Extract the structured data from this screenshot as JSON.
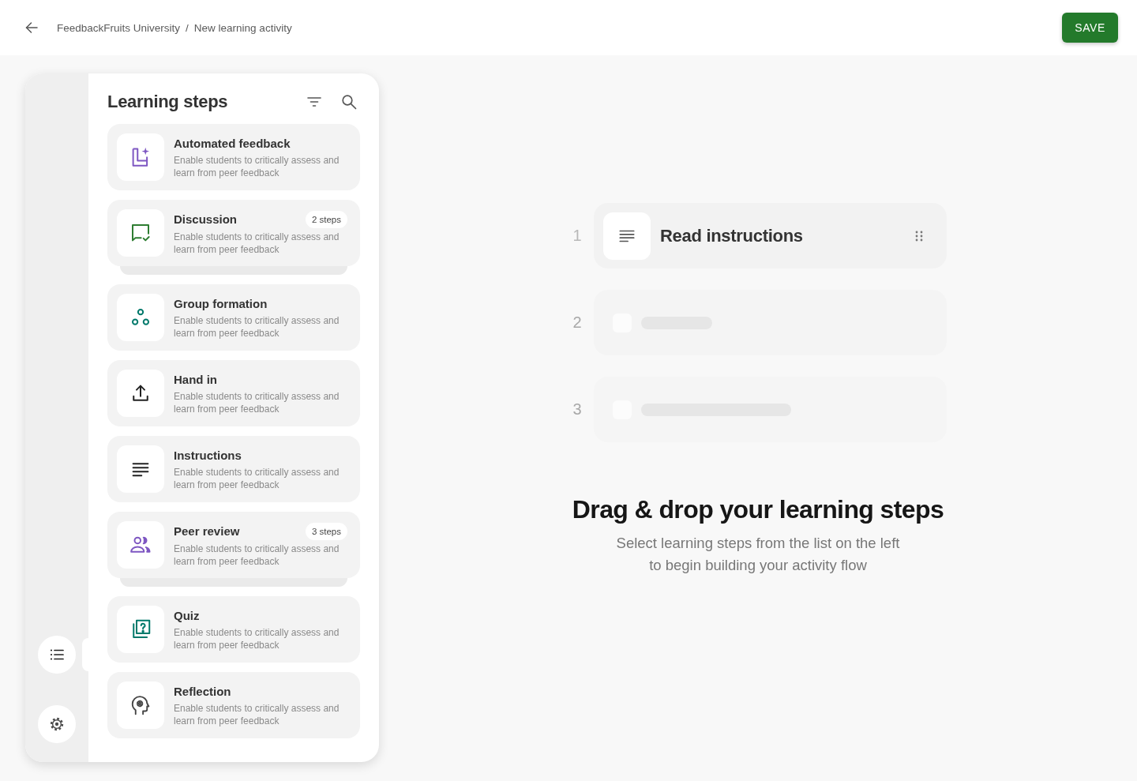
{
  "header": {
    "breadcrumb": {
      "items": [
        "FeedbackFruits University",
        "New learning activity"
      ],
      "separator": "/"
    },
    "save_button": "SAVE"
  },
  "sidebar": {
    "rail": [
      {
        "kind": "list",
        "selected": true
      },
      {
        "kind": "settings",
        "selected": false
      }
    ],
    "title": "Learning steps",
    "steps": [
      {
        "kind": "automated",
        "title": "Automated feedback",
        "description": "Enable students to critically assess and learn from peer feedback"
      },
      {
        "kind": "discussion",
        "title": "Discussion",
        "badge": "2 steps",
        "description": "Enable students to critically assess and learn from peer feedback"
      },
      {
        "kind": "groups",
        "title": "Group formation",
        "description": "Enable students to critically assess and learn from peer feedback"
      },
      {
        "kind": "upload",
        "title": "Hand in",
        "description": "Enable students to critically assess and learn from peer feedback"
      },
      {
        "kind": "instructions",
        "title": "Instructions",
        "description": "Enable students to critically assess and learn from peer feedback"
      },
      {
        "kind": "peer",
        "title": "Peer review",
        "badge": "3 steps",
        "description": "Enable students to critically assess and learn from peer feedback"
      },
      {
        "kind": "quiz",
        "title": "Quiz",
        "description": "Enable students to critically assess and learn from peer feedback"
      },
      {
        "kind": "reflection",
        "title": "Reflection",
        "description": "Enable students to critically assess and learn from peer feedback"
      }
    ]
  },
  "canvas": {
    "slots": [
      {
        "number": "1",
        "kind": "step",
        "title": "Read instructions"
      },
      {
        "number": "2",
        "kind": "empty"
      },
      {
        "number": "3",
        "kind": "empty"
      }
    ],
    "empty_state": {
      "title": "Drag & drop your learning steps",
      "text": "Select learning steps from the list on the left to begin building your activity flow"
    }
  }
}
